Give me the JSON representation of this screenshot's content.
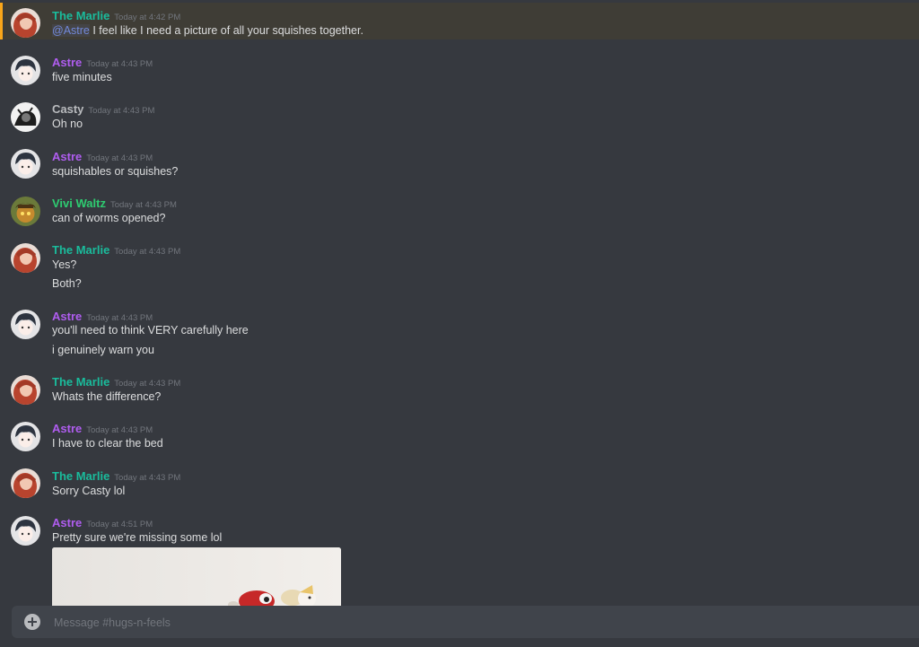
{
  "colors": {
    "marlie": "#1abc9c",
    "astre": "#b05df0",
    "casty": "#b9bbbe",
    "vivi": "#2ecc71",
    "mention_highlight": "#faa61a"
  },
  "messages": [
    {
      "author": "The Marlie",
      "time": "Today at 4:42 PM",
      "mention": "@Astre",
      "lines": [
        "I feel like I need a picture of all your squishes together."
      ],
      "avatar_icon": "marlie-avatar-icon"
    },
    {
      "author": "Astre",
      "time": "Today at 4:43 PM",
      "lines": [
        "five minutes"
      ],
      "avatar_icon": "astre-avatar-icon"
    },
    {
      "author": "Casty",
      "time": "Today at 4:43 PM",
      "lines": [
        "Oh no"
      ],
      "avatar_icon": "casty-avatar-icon"
    },
    {
      "author": "Astre",
      "time": "Today at 4:43 PM",
      "lines": [
        "squishables or squishes?"
      ],
      "avatar_icon": "astre-avatar-icon"
    },
    {
      "author": "Vivi Waltz",
      "time": "Today at 4:43 PM",
      "lines": [
        "can of worms opened?"
      ],
      "avatar_icon": "vivi-avatar-icon"
    },
    {
      "author": "The Marlie",
      "time": "Today at 4:43 PM",
      "lines": [
        "Yes?",
        "Both?"
      ],
      "avatar_icon": "marlie-avatar-icon"
    },
    {
      "author": "Astre",
      "time": "Today at 4:43 PM",
      "lines": [
        "you'll need to think VERY carefully here",
        "i genuinely warn you"
      ],
      "avatar_icon": "astre-avatar-icon"
    },
    {
      "author": "The Marlie",
      "time": "Today at 4:43 PM",
      "lines": [
        "Whats the difference?"
      ],
      "avatar_icon": "marlie-avatar-icon"
    },
    {
      "author": "Astre",
      "time": "Today at 4:43 PM",
      "lines": [
        "I have to clear the bed"
      ],
      "avatar_icon": "astre-avatar-icon"
    },
    {
      "author": "The Marlie",
      "time": "Today at 4:43 PM",
      "lines": [
        "Sorry Casty lol"
      ],
      "avatar_icon": "marlie-avatar-icon"
    },
    {
      "author": "Astre",
      "time": "Today at 4:51 PM",
      "lines": [
        "Pretty sure we're missing some lol"
      ],
      "avatar_icon": "astre-avatar-icon"
    }
  ],
  "composer": {
    "placeholder": "Message #hugs-n-feels",
    "upload_icon": "plus-circle-icon"
  },
  "attachment": {
    "icon": "image-attachment-icon"
  }
}
